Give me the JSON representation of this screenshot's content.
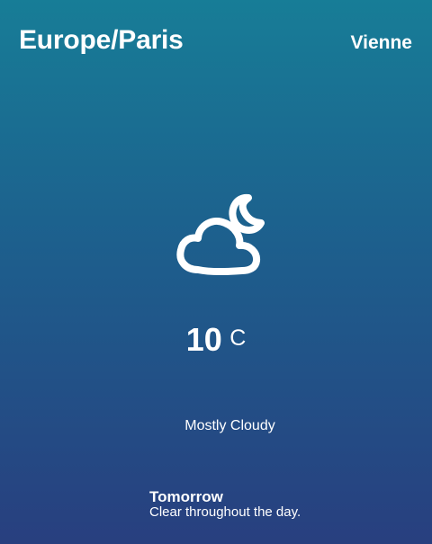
{
  "header": {
    "timezone": "Europe/Paris",
    "city": "Vienne"
  },
  "current": {
    "icon": "partly-cloudy-night-icon",
    "temperature": "10",
    "unit": "C",
    "condition": "Mostly Cloudy"
  },
  "forecast": {
    "title": "Tomorrow",
    "summary": "Clear throughout the day."
  },
  "colors": {
    "background_top": "#177d97",
    "background_bottom": "#283f7f",
    "text": "#ffffff"
  }
}
